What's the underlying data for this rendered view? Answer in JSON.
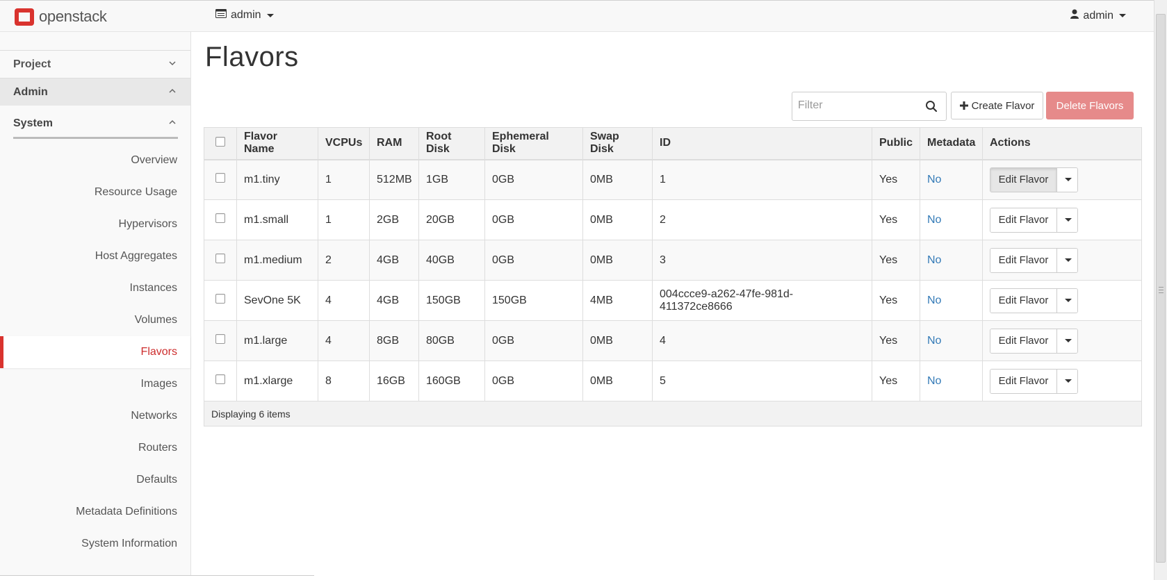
{
  "brand": {
    "logo_text": "openstack",
    "accent": "#d9332e"
  },
  "navbar": {
    "project_label": "admin",
    "user_label": "admin"
  },
  "sidebar": {
    "groups": [
      {
        "label": "Project",
        "expanded": false
      },
      {
        "label": "Admin",
        "expanded": true
      }
    ],
    "subgroup": {
      "label": "System",
      "expanded": true
    },
    "items": [
      {
        "label": "Overview"
      },
      {
        "label": "Resource Usage"
      },
      {
        "label": "Hypervisors"
      },
      {
        "label": "Host Aggregates"
      },
      {
        "label": "Instances"
      },
      {
        "label": "Volumes"
      },
      {
        "label": "Flavors",
        "active": true
      },
      {
        "label": "Images"
      },
      {
        "label": "Networks"
      },
      {
        "label": "Routers"
      },
      {
        "label": "Defaults"
      },
      {
        "label": "Metadata Definitions"
      },
      {
        "label": "System Information"
      }
    ]
  },
  "page": {
    "title": "Flavors"
  },
  "toolbar": {
    "filter_placeholder": "Filter",
    "create_label": "Create Flavor",
    "delete_label": "Delete Flavors"
  },
  "table": {
    "columns": [
      "Flavor Name",
      "VCPUs",
      "RAM",
      "Root Disk",
      "Ephemeral Disk",
      "Swap Disk",
      "ID",
      "Public",
      "Metadata",
      "Actions"
    ],
    "rows": [
      {
        "name": "m1.tiny",
        "vcpus": "1",
        "ram": "512MB",
        "root_disk": "1GB",
        "ephemeral": "0GB",
        "swap": "0MB",
        "id": "1",
        "public": "Yes",
        "metadata": "No",
        "action": "Edit Flavor"
      },
      {
        "name": "m1.small",
        "vcpus": "1",
        "ram": "2GB",
        "root_disk": "20GB",
        "ephemeral": "0GB",
        "swap": "0MB",
        "id": "2",
        "public": "Yes",
        "metadata": "No",
        "action": "Edit Flavor"
      },
      {
        "name": "m1.medium",
        "vcpus": "2",
        "ram": "4GB",
        "root_disk": "40GB",
        "ephemeral": "0GB",
        "swap": "0MB",
        "id": "3",
        "public": "Yes",
        "metadata": "No",
        "action": "Edit Flavor"
      },
      {
        "name": "SevOne 5K",
        "vcpus": "4",
        "ram": "4GB",
        "root_disk": "150GB",
        "ephemeral": "150GB",
        "swap": "4MB",
        "id": "004ccce9-a262-47fe-981d-411372ce8666",
        "public": "Yes",
        "metadata": "No",
        "action": "Edit Flavor"
      },
      {
        "name": "m1.large",
        "vcpus": "4",
        "ram": "8GB",
        "root_disk": "80GB",
        "ephemeral": "0GB",
        "swap": "0MB",
        "id": "4",
        "public": "Yes",
        "metadata": "No",
        "action": "Edit Flavor"
      },
      {
        "name": "m1.xlarge",
        "vcpus": "8",
        "ram": "16GB",
        "root_disk": "160GB",
        "ephemeral": "0GB",
        "swap": "0MB",
        "id": "5",
        "public": "Yes",
        "metadata": "No",
        "action": "Edit Flavor"
      }
    ],
    "footer": "Displaying 6 items"
  }
}
